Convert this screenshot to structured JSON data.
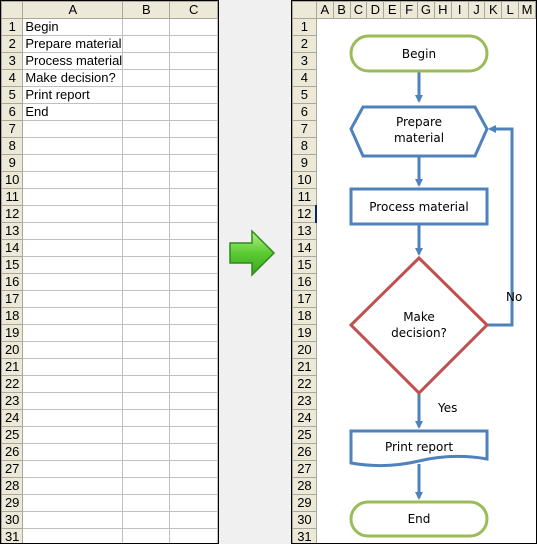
{
  "left_sheet": {
    "columns": [
      "A",
      "B",
      "C"
    ],
    "rows": [
      {
        "n": "1",
        "a": "Begin"
      },
      {
        "n": "2",
        "a": "Prepare material"
      },
      {
        "n": "3",
        "a": "Process material"
      },
      {
        "n": "4",
        "a": "Make decision?"
      },
      {
        "n": "5",
        "a": "Print report"
      },
      {
        "n": "6",
        "a": "End"
      },
      {
        "n": "7",
        "a": ""
      },
      {
        "n": "8",
        "a": ""
      },
      {
        "n": "9",
        "a": ""
      },
      {
        "n": "10",
        "a": ""
      },
      {
        "n": "11",
        "a": ""
      },
      {
        "n": "12",
        "a": ""
      },
      {
        "n": "13",
        "a": ""
      },
      {
        "n": "14",
        "a": ""
      },
      {
        "n": "15",
        "a": ""
      },
      {
        "n": "16",
        "a": ""
      },
      {
        "n": "17",
        "a": ""
      },
      {
        "n": "18",
        "a": ""
      },
      {
        "n": "19",
        "a": ""
      },
      {
        "n": "20",
        "a": ""
      },
      {
        "n": "21",
        "a": ""
      },
      {
        "n": "22",
        "a": ""
      },
      {
        "n": "23",
        "a": ""
      },
      {
        "n": "24",
        "a": ""
      },
      {
        "n": "25",
        "a": ""
      },
      {
        "n": "26",
        "a": ""
      },
      {
        "n": "27",
        "a": ""
      },
      {
        "n": "28",
        "a": ""
      },
      {
        "n": "29",
        "a": ""
      },
      {
        "n": "30",
        "a": ""
      },
      {
        "n": "31",
        "a": ""
      }
    ]
  },
  "right_sheet": {
    "columns": [
      "A",
      "B",
      "C",
      "D",
      "E",
      "F",
      "G",
      "H",
      "I",
      "J",
      "K",
      "L",
      "M"
    ],
    "row_count": 31,
    "selected_row": "12"
  },
  "transform_arrow": {
    "icon": "right-arrow-icon",
    "color": "#4cbb2c"
  },
  "flowchart": {
    "colors": {
      "terminal": "#9bbb59",
      "process": "#4f81bd",
      "decision": "#c0504d",
      "connector": "#4f81bd"
    },
    "begin": "Begin",
    "prepare": [
      "Prepare",
      "material"
    ],
    "process": "Process material",
    "decision": [
      "Make",
      "decision?"
    ],
    "report": "Print report",
    "end": "End",
    "no_label": "No",
    "yes_label": "Yes"
  }
}
